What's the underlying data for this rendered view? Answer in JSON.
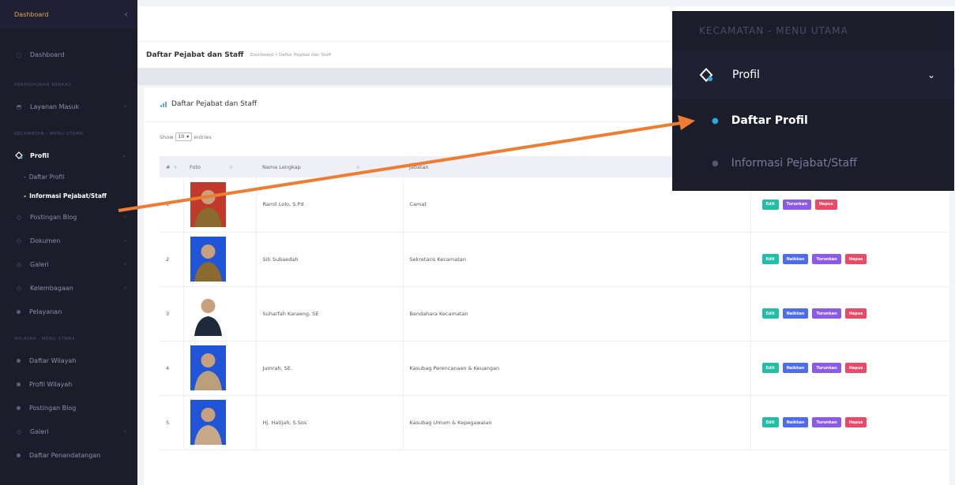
{
  "sidebar": {
    "brand": "Dashboard",
    "items": [
      {
        "label": "Dashboard"
      },
      {
        "label": "Layanan Masuk"
      },
      {
        "label": "Profil"
      },
      {
        "label": "Postingan Blog"
      },
      {
        "label": "Dokumen"
      },
      {
        "label": "Galeri"
      },
      {
        "label": "Kelembagaan"
      },
      {
        "label": "Pelayanan"
      },
      {
        "label": "Daftar Wilayah"
      },
      {
        "label": "Profil Wilayah"
      },
      {
        "label": "Postingan Blog"
      },
      {
        "label": "Galeri"
      },
      {
        "label": "Daftar Penandatangan"
      }
    ],
    "sections": [
      "PERMOHONAN BERKAS",
      "KECAMATAN - MENU UTAMA",
      "WILAYAH - MENU UTAMA"
    ],
    "submenu": [
      "Daftar Profil",
      "Informasi Pejabat/Staff"
    ]
  },
  "page": {
    "title": "Daftar Pejabat dan Staff",
    "breadcrumb": "Dashboard • Daftar Pejabat dan Staff"
  },
  "card": {
    "title": "Daftar Pejabat dan Staff",
    "show_label": "Show",
    "entries_value": "10",
    "entries_label": "entries"
  },
  "table": {
    "headers": [
      "#",
      "Foto",
      "Nama Lengkap",
      "Jabatan"
    ],
    "rows": [
      {
        "no": "1",
        "name": "Ramli Lolo, S.Pd.",
        "jabatan": "Camat"
      },
      {
        "no": "2",
        "name": "Siti Subaedah",
        "jabatan": "Sekretaris Kecamatan"
      },
      {
        "no": "3",
        "name": "Suharfah Karaeng, SE",
        "jabatan": "Bendahara Kecamatan"
      },
      {
        "no": "4",
        "name": "Jumrah, SE.",
        "jabatan": "Kasubag Perencanaan & Keuangan"
      },
      {
        "no": "5",
        "name": "Hj. Hatijah, S.Sos",
        "jabatan": "Kasubag Umum & Kepegawaian"
      }
    ],
    "buttons": {
      "edit": "Edit",
      "nolak": "Naikkan",
      "turun": "Turunkan",
      "hapus": "Hapus"
    }
  },
  "zoom": {
    "section": "KECAMATAN - MENU UTAMA",
    "profil": "Profil",
    "sub1": "Daftar Profil",
    "sub2": "Informasi Pejabat/Staff"
  },
  "colors": {
    "accent": "#2da9e1",
    "sidebar_bg": "#1c1d2b",
    "arrow": "#ee7d31"
  }
}
